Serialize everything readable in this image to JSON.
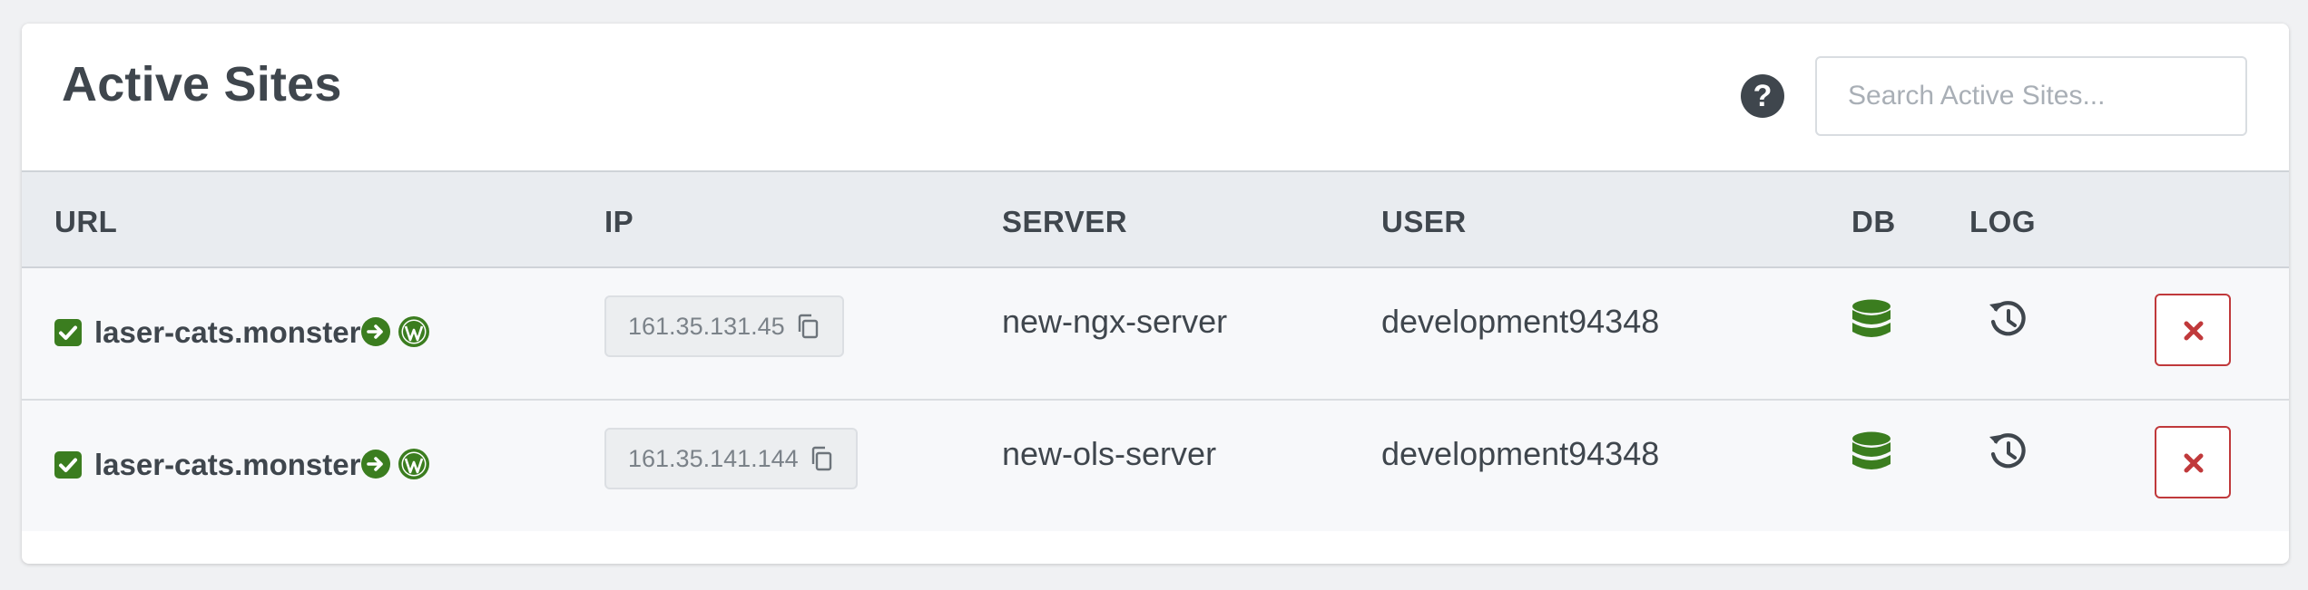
{
  "header": {
    "title": "Active Sites",
    "help_label": "?",
    "search_placeholder": "Search Active Sites..."
  },
  "columns": {
    "url": "URL",
    "ip": "IP",
    "server": "SERVER",
    "user": "USER",
    "db": "DB",
    "log": "LOG"
  },
  "rows": [
    {
      "checked": true,
      "url": "laser-cats.monster",
      "ip": "161.35.131.45",
      "server": "new-ngx-server",
      "user": "development94348"
    },
    {
      "checked": true,
      "url": "laser-cats.monster",
      "ip": "161.35.141.144",
      "server": "new-ols-server",
      "user": "development94348"
    }
  ],
  "icons": {
    "check": "checkbox-checked-icon",
    "go": "arrow-circle-right-icon",
    "wordpress": "wordpress-icon",
    "copy": "copy-icon",
    "db": "database-icon",
    "log": "history-icon",
    "delete": "close-x-icon"
  },
  "colors": {
    "accent_green": "#3b7d1f",
    "danger_red": "#c0393b",
    "text_dark": "#3f464d",
    "header_bg": "#e9ecf0",
    "row_bg": "#f7f8fa"
  }
}
